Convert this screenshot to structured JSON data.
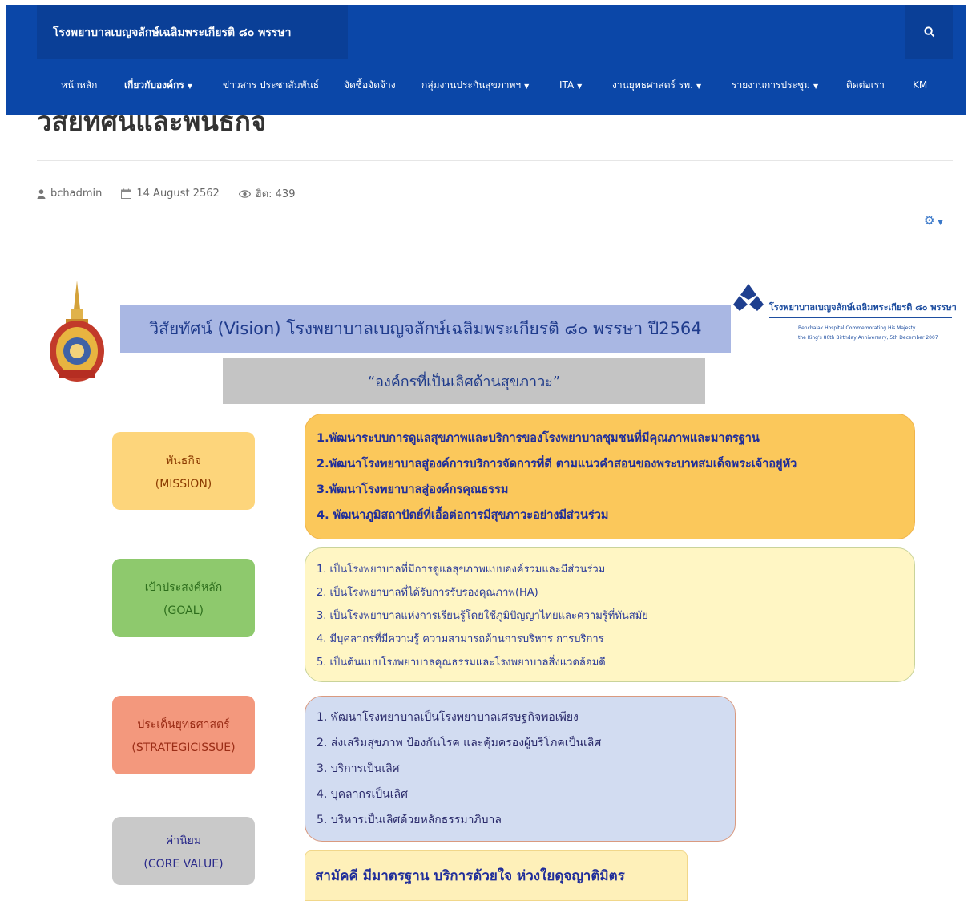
{
  "header": {
    "site_title": "โรงพยาบาลเบญจลักษ์เฉลิมพระเกียรติ ๘๐ พรรษา",
    "search_icon": "search-icon"
  },
  "nav": {
    "items": [
      {
        "label": "หน้าหลัก",
        "dropdown": false
      },
      {
        "label": "เกี่ยวกับองค์กร",
        "dropdown": true,
        "active": true
      },
      {
        "label": "ข่าวสาร ประชาสัมพันธ์",
        "dropdown": false
      },
      {
        "label": "จัดซื้อจัดจ้าง",
        "dropdown": false
      },
      {
        "label": "กลุ่มงานประกันสุขภาพฯ",
        "dropdown": true
      },
      {
        "label": "ITA",
        "dropdown": true
      },
      {
        "label": "งานยุทธศาสตร์ รพ.",
        "dropdown": true
      },
      {
        "label": "รายงานการประชุม",
        "dropdown": true
      },
      {
        "label": "ติดต่อเรา",
        "dropdown": false
      },
      {
        "label": "KM",
        "dropdown": false
      }
    ]
  },
  "article": {
    "title": "วิสัยทัศน์และพันธกิจ",
    "author": "bchadmin",
    "date": "14 August 2562",
    "hits": "ฮิต: 439",
    "icons": {
      "author": "user-icon",
      "date": "calendar-icon",
      "hits": "eye-icon",
      "tools": "gear-icon"
    }
  },
  "infographic": {
    "logo_name": "โรงพยาบาลเบญจลักษ์เฉลิมพระเกียรติ ๘๐ พรรษา",
    "logo_sub_1": "Benchalak Hospital Commemorating His Majesty",
    "logo_sub_2": "the King's 80th Birthday Anniversary, 5th December 2007",
    "vision": "วิสัยทัศน์ (Vision)  โรงพยาบาลเบญจลักษ์เฉลิมพระเกียรติ ๘๐  พรรษา ปี2564",
    "tagline": "“องค์กรที่เป็นเลิศด้านสุขภาวะ”",
    "mission": {
      "label_th": "พันธกิจ",
      "label_en": "(MISSION)",
      "items": [
        "1.พัฒนาระบบการดูแลสุขภาพและบริการของโรงพยาบาลชุมชนที่มีคุณภาพและมาตรฐาน",
        "2.พัฒนาโรงพยาบาลสู่องค์การบริการจัดการที่ดี ตามแนวคำสอนของพระบาทสมเด็จพระเจ้าอยู่หัว",
        "3.พัฒนาโรงพยาบาลสู่องค์กรคุณธรรม",
        "4. พัฒนาภูมิสถาปัตย์ที่เอื้อต่อการมีสุขภาวะอย่างมีส่วนร่วม"
      ]
    },
    "goal": {
      "label_th": "เป้าประสงค์หลัก",
      "label_en": "(GOAL)",
      "items": [
        "1. เป็นโรงพยาบาลที่มีการดูแลสุขภาพแบบองค์รวมและมีส่วนร่วม",
        "2. เป็นโรงพยาบาลที่ได้รับการรับรองคุณภาพ(HA)",
        "3. เป็นโรงพยาบาลแห่งการเรียนรู้โดยใช้ภูมิปัญญาไทยและความรู้ที่ทันสมัย",
        "4. มีบุคลากรที่มีความรู้ ความสามารถด้านการบริหาร การบริการ",
        "5. เป็นต้นแบบโรงพยาบาลคุณธรรมและโรงพยาบาลสิ่งแวดล้อมดี"
      ]
    },
    "strategy": {
      "label_th": "ประเด็นยุทธศาสตร์",
      "label_en": "(STRATEGICISSUE)",
      "items": [
        "1. พัฒนาโรงพยาบาลเป็นโรงพยาบาลเศรษฐกิจพอเพียง",
        "2. ส่งเสริมสุขภาพ ป้องกันโรค และคุ้มครองผู้บริโภคเป็นเลิศ",
        "3. บริการเป็นเลิศ",
        "4. บุคลากรเป็นเลิศ",
        "5. บริหารเป็นเลิศด้วยหลักธรรมาภิบาล"
      ]
    },
    "value": {
      "label_th": "ค่านิยม",
      "label_en": "(CORE VALUE)",
      "text": "สามัคคี  มีมาตรฐาน  บริการด้วยใจ  ห่วงใยดุจญาติมิตร"
    }
  },
  "colors": {
    "nav_bg": "#0b47a8",
    "vision_bg": "#a9b7e3",
    "mission_bg": "#fbc85b",
    "goal_bg": "#fff6c4",
    "strategy_bg": "#d2dcf1",
    "value_bg": "#fef0b9"
  }
}
